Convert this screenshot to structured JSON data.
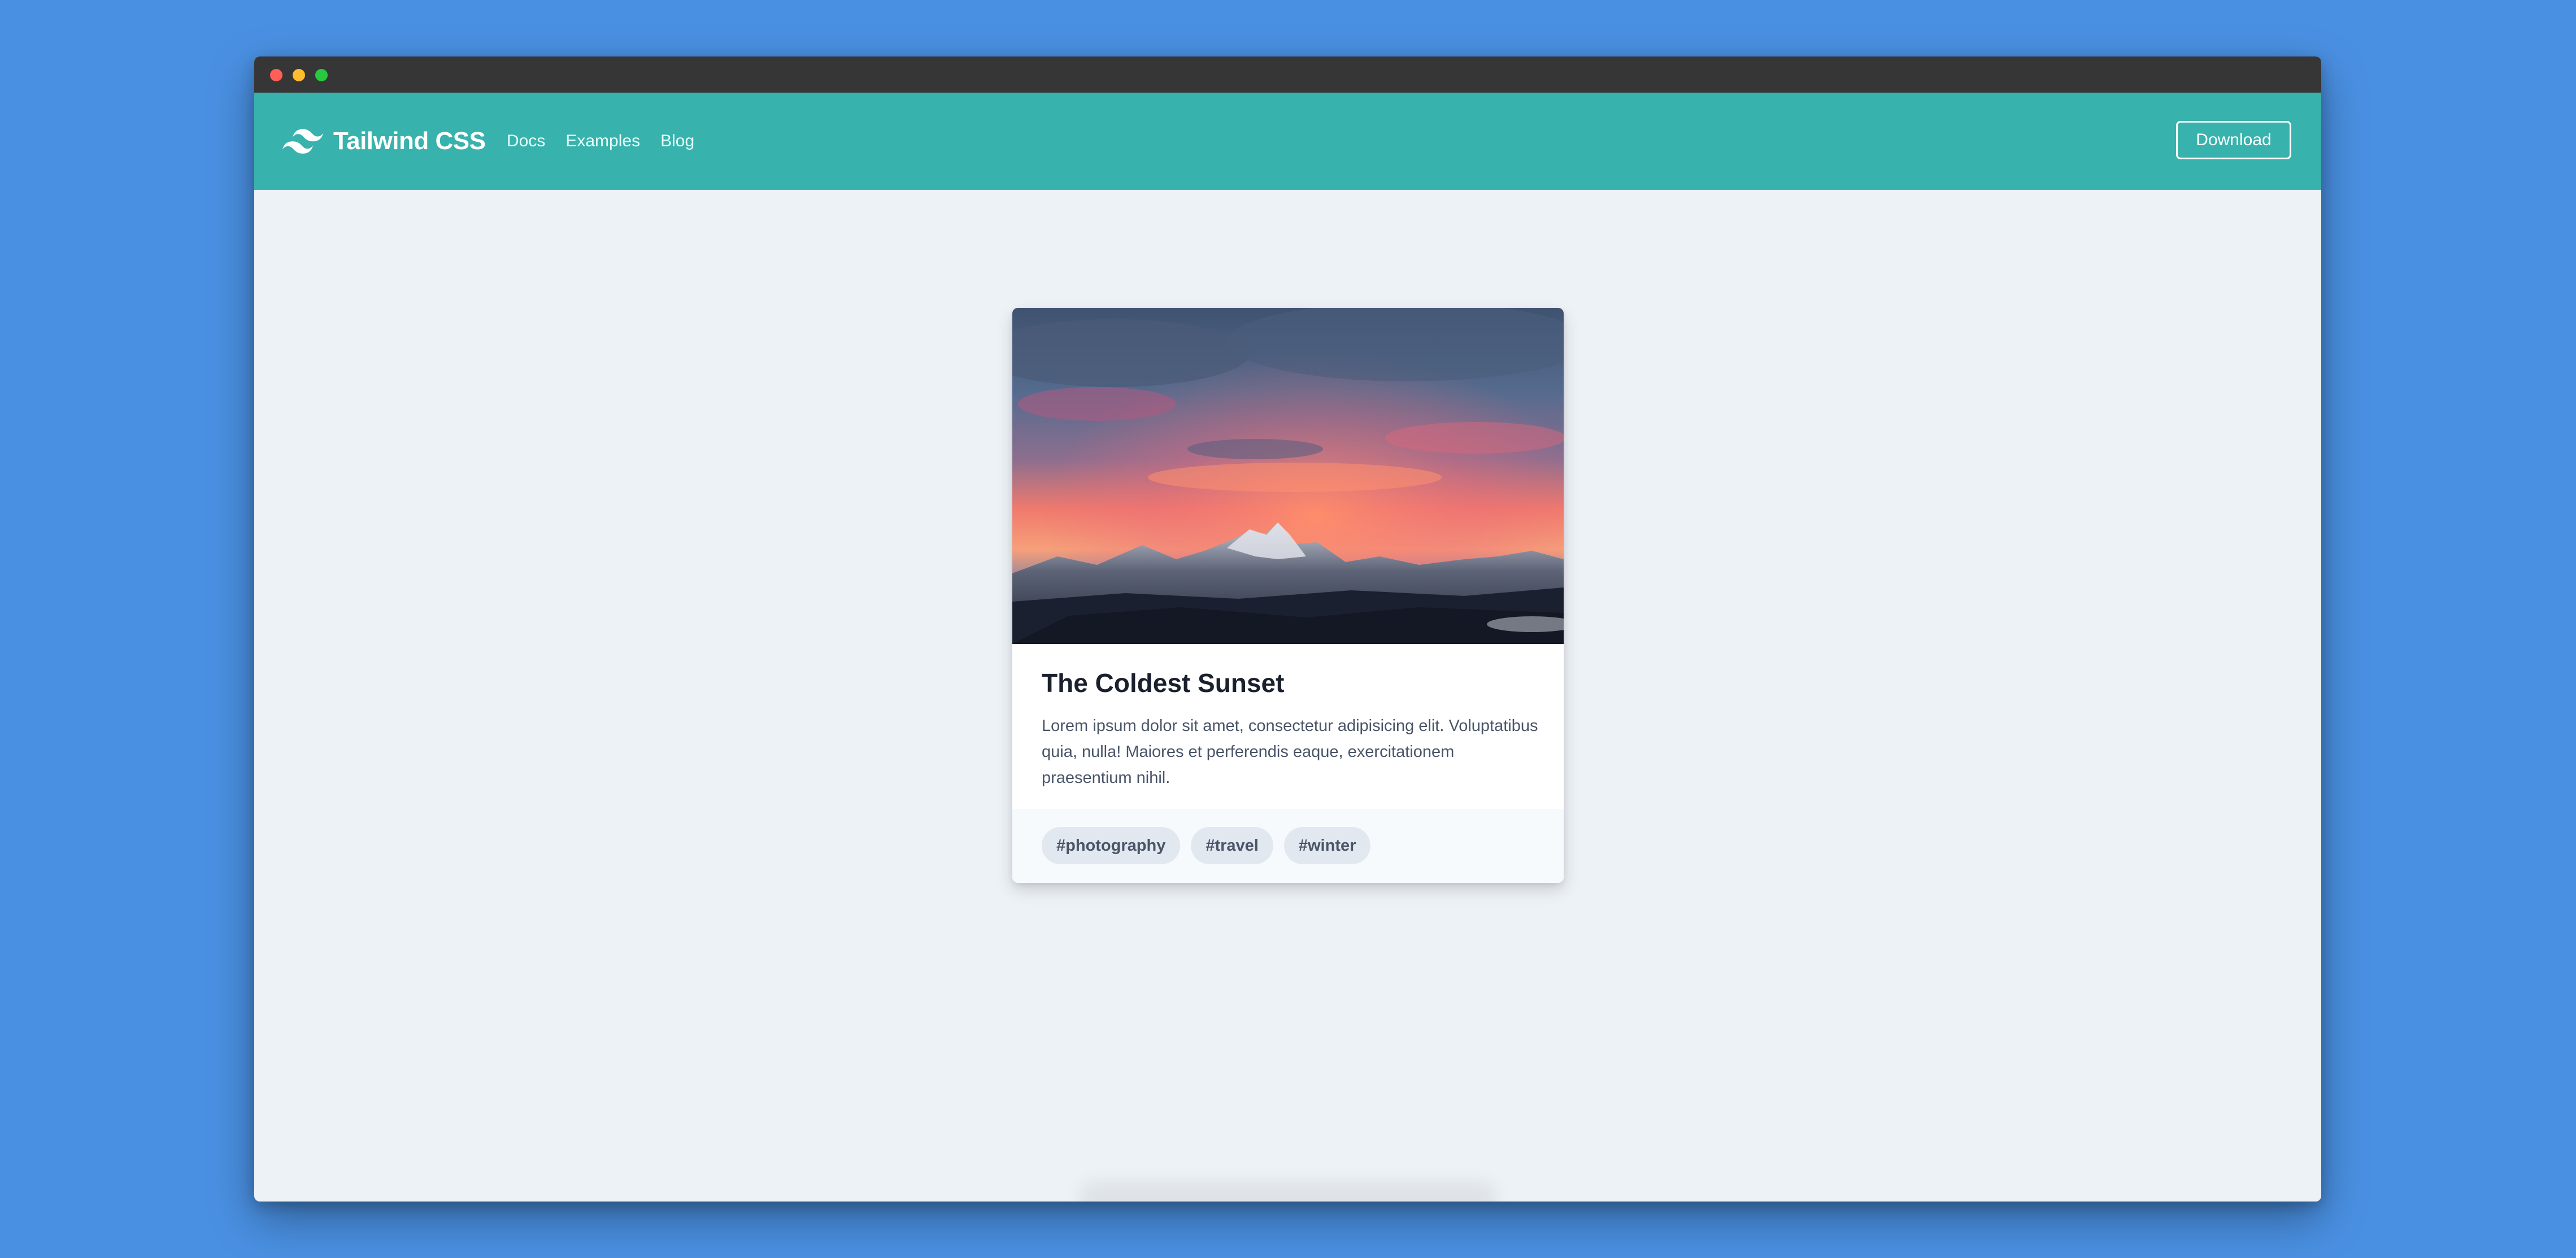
{
  "window": {
    "controls": [
      "close",
      "minimize",
      "maximize"
    ]
  },
  "navbar": {
    "brand": "Tailwind CSS",
    "links": [
      {
        "label": "Docs"
      },
      {
        "label": "Examples"
      },
      {
        "label": "Blog"
      }
    ],
    "download_label": "Download",
    "background_color": "#38b2ac"
  },
  "card": {
    "title": "The Coldest Sunset",
    "description": "Lorem ipsum dolor sit amet, consectetur adipisicing elit. Voluptatibus quia, nulla! Maiores et perferendis eaque, exercitationem praesentium nihil.",
    "image": "sunset over snowy mountains",
    "tags": [
      {
        "label": "#photography"
      },
      {
        "label": "#travel"
      },
      {
        "label": "#winter"
      }
    ]
  },
  "colors": {
    "page_background": "#4a90e2",
    "content_background": "#edf2f7",
    "tag_background": "#e2e8f0"
  }
}
